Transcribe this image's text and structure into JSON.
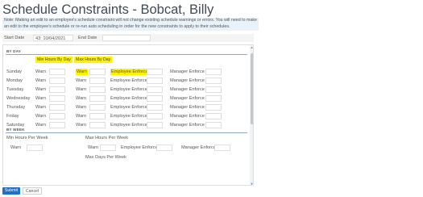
{
  "page": {
    "title": "Schedule Constraints - Bobcat, Billy",
    "note": "Note: Making an edit to an employee's schedule constraint will not change existing schedule warnings or errors. You will need to make an edit to the employee's schedule or re-run auto scheduling in order for the new constraints to apply to their schedules."
  },
  "dates": {
    "start_label": "Start Date",
    "start_value": "43: 10/04/2021",
    "end_label": "End Date",
    "end_value": ""
  },
  "by_day": {
    "section_label": "BY DAY",
    "min_header": "Min Hours By Day",
    "max_header": "Max Hours By Day",
    "labels": {
      "warn_min": "Warn",
      "warn_max": "Warn",
      "employee_enforce": "Employee Enforce",
      "manager_enforce": "Manager Enforce"
    },
    "rows": [
      {
        "day": "Sunday"
      },
      {
        "day": "Monday"
      },
      {
        "day": "Tuesday"
      },
      {
        "day": "Wednesday"
      },
      {
        "day": "Thursday"
      },
      {
        "day": "Friday"
      },
      {
        "day": "Saturday"
      }
    ]
  },
  "by_week": {
    "section_label": "BY WEEK",
    "min_label": "Min Hours Per Week",
    "max_label": "Max Hours Per Week",
    "warn_min": "Warn",
    "warn_max": "Warn",
    "employee_enforce": "Employee Enforce",
    "manager_enforce": "Manager Enforce",
    "max_days_label": "Max Days Per Week"
  },
  "actions": {
    "submit": "Submit",
    "cancel": "Cancel"
  },
  "colors": {
    "highlight": "#fff200",
    "primary": "#1f6fc5",
    "note_bg": "#e9f1f9"
  }
}
